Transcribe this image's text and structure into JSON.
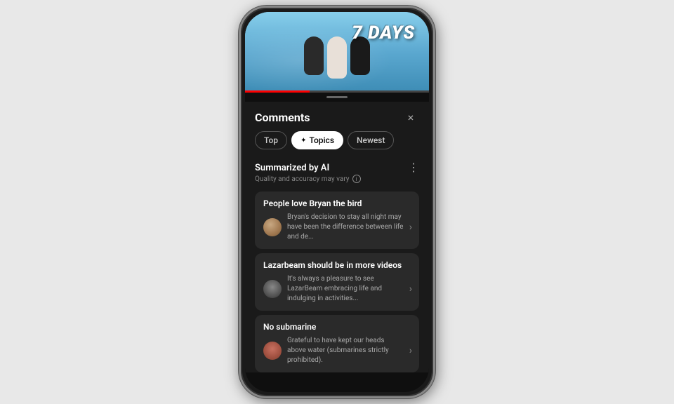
{
  "video": {
    "days_label": "7 DAYS",
    "progress_percent": 35
  },
  "comments": {
    "title": "Comments",
    "close_label": "×",
    "tabs": [
      {
        "id": "top",
        "label": "Top",
        "active": false
      },
      {
        "id": "topics",
        "label": "Topics",
        "active": true,
        "icon": "✦"
      },
      {
        "id": "newest",
        "label": "Newest",
        "active": false
      }
    ],
    "ai_section": {
      "title": "Summarized by AI",
      "subtitle": "Quality and accuracy may vary",
      "more_icon": "⋮"
    },
    "topics": [
      {
        "id": 1,
        "title": "People love Bryan the bird",
        "preview": "Bryan's decision to stay all night may have been the difference between life and de...",
        "avatar_type": "avatar-1"
      },
      {
        "id": 2,
        "title": "Lazarbeam should be in more videos",
        "preview": "It's always a pleasure to see LazarBeam embracing life and indulging in activities...",
        "avatar_type": "avatar-2"
      },
      {
        "id": 3,
        "title": "No submarine",
        "preview": "Grateful to have kept our heads above water (submarines strictly prohibited).",
        "avatar_type": "avatar-3"
      }
    ]
  }
}
